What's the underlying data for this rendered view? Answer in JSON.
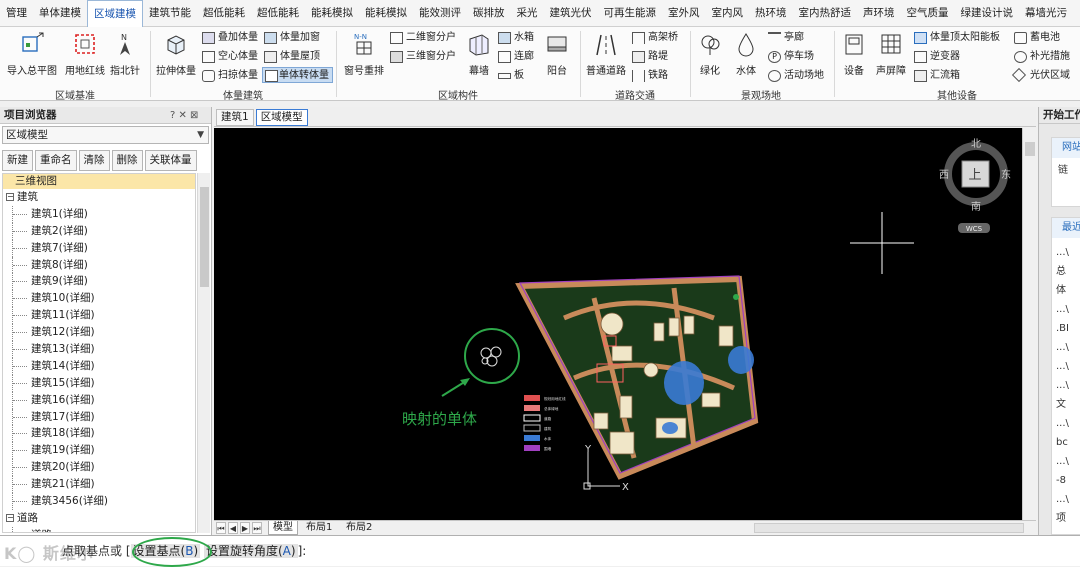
{
  "menu": [
    "管理",
    "单体建模",
    "区域建模",
    "建筑节能",
    "超低能耗",
    "超低能耗",
    "能耗模拟",
    "能耗模拟",
    "能效测评",
    "碳排放",
    "采光",
    "建筑光伏",
    "可再生能源",
    "室外风",
    "室内风",
    "热环境",
    "室内热舒适",
    "声环境",
    "空气质量",
    "绿建设计说",
    "幕墙光污"
  ],
  "menu_active_index": 2,
  "ribbon": {
    "groups": [
      {
        "label": "区域基准"
      },
      {
        "label": "体量建筑"
      },
      {
        "label": "区域构件"
      },
      {
        "label": "道路交通"
      },
      {
        "label": "景观场地"
      },
      {
        "label": "其他设备"
      }
    ],
    "big_buttons": {
      "import_plan": "导入总平图",
      "red_line": "用地红线",
      "north": "指北针",
      "extrude": "拉伸体量",
      "window_repeat": "窗号重排",
      "curtain": "幕墙",
      "balcony": "阳台",
      "road": "普通道路",
      "green": "绿化",
      "water": "水体",
      "device": "设备",
      "sound_barrier": "声屏障"
    },
    "small_buttons": {
      "stack_mass": "叠加体量",
      "add_window": "体量加窗",
      "hollow_mass": "空心体量",
      "mass_roof": "体量屋顶",
      "sweep_mass": "扫掠体量",
      "mass_to_single": "单体转体量",
      "win_2d": "二维窗分户",
      "win_3d": "三维窗分户",
      "water_tank": "水箱",
      "corridor": "连廊",
      "slab": "板",
      "elevated_bridge": "高架桥",
      "road_embank": "路堤",
      "rail": "铁路",
      "pavilion": "亭廊",
      "parking": "停车场",
      "activity": "活动场地",
      "pv_panel": "体量顶太阳能板",
      "inverter": "逆变器",
      "combiner": "汇流箱",
      "battery": "蓄电池",
      "supplement": "补光措施",
      "pv_zone": "光伏区域"
    }
  },
  "left_panel": {
    "title": "项目浏览器",
    "title_tools": "? ✕ ⊠",
    "select_value": "区域模型",
    "buttons": [
      "新建",
      "重命名",
      "清除",
      "删除",
      "关联体量"
    ],
    "tree_header": "三维视图",
    "category_building": "建筑",
    "buildings": [
      "建筑1(详细)",
      "建筑2(详细)",
      "建筑7(详细)",
      "建筑8(详细)",
      "建筑9(详细)",
      "建筑10(详细)",
      "建筑11(详细)",
      "建筑12(详细)",
      "建筑13(详细)",
      "建筑14(详细)",
      "建筑15(详细)",
      "建筑16(详细)",
      "建筑17(详细)",
      "建筑18(详细)",
      "建筑19(详细)",
      "建筑20(详细)",
      "建筑21(详细)",
      "建筑3456(详细)"
    ],
    "category_road": "道路",
    "road_item": "道路"
  },
  "doc_tabs": [
    "建筑1",
    "区域模型"
  ],
  "doc_tab_active": 1,
  "viewport": {
    "viewcube": {
      "north": "北",
      "south": "南",
      "east": "东",
      "west": "西",
      "top": "上",
      "wcs": "WCS"
    },
    "annotation": "映射的单体",
    "axis_y": "Y",
    "axis_x": "X",
    "legend_colors": [
      "#e05050",
      "#e87a7a",
      "#ffffff",
      "#c0c0c0",
      "#3a7bd5",
      "#a040c0"
    ],
    "legend_labels": [
      "规划用地红线",
      "总体绿地",
      "道路",
      "建筑",
      "水体",
      "围墙"
    ]
  },
  "layout_tabs": [
    "模型",
    "布局1",
    "布局2"
  ],
  "layout_tab_active": 0,
  "right_panel": {
    "title": "开始工作",
    "card1_header": "网站",
    "card1_line": "链",
    "card2_header": "最近",
    "recent_lines": [
      "...\\",
      "总",
      "体",
      "...\\",
      ".BI",
      "...\\",
      "...\\",
      "...\\",
      "文",
      "...\\",
      "bc",
      "...\\",
      "-8",
      "...\\",
      "项"
    ]
  },
  "cmdline": {
    "prefix": "点取基点或 [",
    "opt1_label": "设置基点",
    "opt1_key": "B",
    "opt2_label": "设置旋转角度",
    "opt2_key": "A",
    "suffix": "]:",
    "watermark": "K◯ 斯维尔"
  },
  "colors": {
    "accent": "#1a56b0",
    "annotation_green": "#2ea84a",
    "viewport_bg": "#000000"
  }
}
